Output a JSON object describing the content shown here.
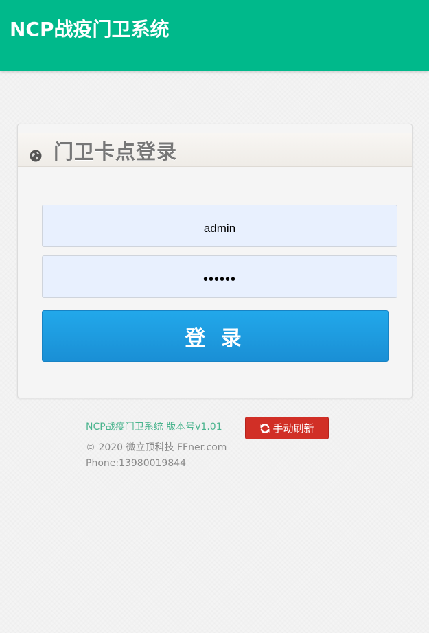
{
  "header": {
    "app_title": "NCP战疫门卫系统",
    "background_color": "#00b98b"
  },
  "login_card": {
    "title": "门卫卡点登录",
    "title_icon": "globe-icon",
    "username_value": "admin",
    "password_value": "••••••",
    "login_button_label": "登 录",
    "button_color": "#1e9de0"
  },
  "footer": {
    "version_text": "NCP战疫门卫系统 版本号v1.01",
    "refresh_button_label": "手动刷新",
    "refresh_icon": "refresh-icon",
    "copyright_text": "© 2020 微立顶科技 FFner.com",
    "phone_text": "Phone:13980019844"
  }
}
